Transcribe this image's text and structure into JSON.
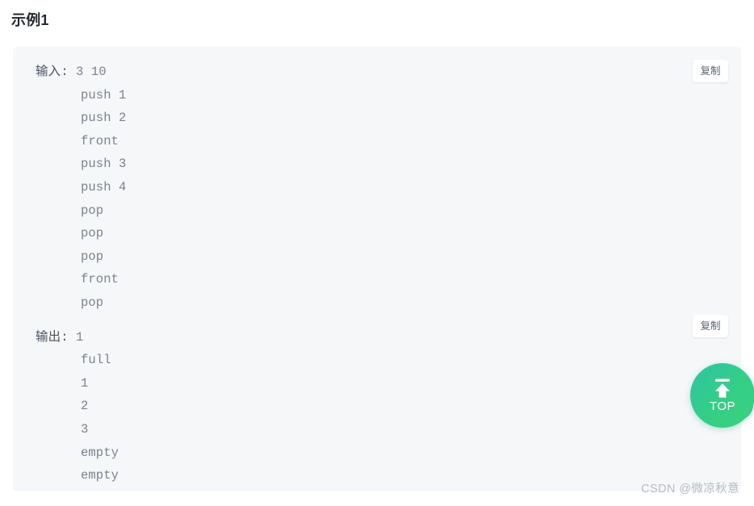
{
  "heading": {
    "title": "示例1"
  },
  "code_block": {
    "background_color": "#f6f7f9",
    "text_color": "#7b8290",
    "label_color": "#4c5361",
    "input": {
      "label": "输入:",
      "lines": [
        "3 10",
        "push 1",
        "push 2",
        "front",
        "push 3",
        "push 4",
        "pop",
        "pop",
        "pop",
        "front",
        "pop"
      ]
    },
    "output": {
      "label": "输出:",
      "lines": [
        "1",
        "full",
        "1",
        "2",
        "3",
        "empty",
        "empty"
      ]
    },
    "copy_button_input": {
      "label": "复制",
      "icon": "copy-icon"
    },
    "copy_button_output": {
      "label": "复制",
      "icon": "copy-icon"
    }
  },
  "back_to_top": {
    "label": "TOP",
    "icon": "upload-arrow-icon",
    "accent_color": "#34cf86"
  },
  "watermark": {
    "text": "CSDN @微凉秋意"
  }
}
